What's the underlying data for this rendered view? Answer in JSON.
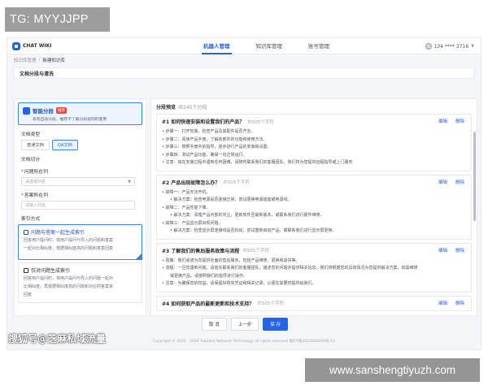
{
  "overlay": {
    "top_left_tag": "TG: MYYJJPP",
    "bottom_left_watermark": "搜狐号@芝麻私域流量",
    "bottom_right_tag": "www.sanshengtiyuzh.com"
  },
  "app": {
    "logo": "CHAT WIKI",
    "nav": [
      "机器人管理",
      "知识库管理",
      "账号管理"
    ],
    "active_nav": "机器人管理",
    "user": "134 **** 3716"
  },
  "breadcrumb": {
    "parent": "知识库管理",
    "sep": "/",
    "current": "新建知识库"
  },
  "section_title": "文档分段与清洗",
  "left": {
    "mode": {
      "title": "智能分段",
      "badge": "推荐",
      "desc": "系统自动分段，推荐不了解分段规则的使用"
    },
    "doc_type_label": "文档类型",
    "doc_types": [
      "普通文档",
      "QA文档"
    ],
    "active_doc_type": "QA文档",
    "split_label": "文档切分",
    "q_col_label": "问题所在列",
    "q_col_placeholder": "请选择列名",
    "a_col_label": "答案所在列",
    "a_col_placeholder": "请输入列名",
    "index_label": "索引方式",
    "index_options": [
      {
        "title": "问题与答案一起生成索引",
        "desc": "回答用户提问时，将用户提问与导入的问题和答案",
        "desc2": "一起对比相似度，根据相似度高的问题和答案回复"
      },
      {
        "title": "仅对问题生成索引",
        "desc": "回答用户提问时，将用户提问与导入的问题一起对",
        "desc2": "比相似度，再根据相似度高的问题和对应的答案来",
        "desc3": "回复"
      }
    ]
  },
  "preview": {
    "title": "分段预览",
    "count": "共345个分段",
    "edit": "编辑",
    "delete": "删除",
    "items": [
      {
        "head": "#1 如何快速安装和设置我们的产品？",
        "chars": "共505个字符",
        "lines": [
          "• 步骤一：打开包装，检查产品及其配件是否齐全。",
          "• 步骤二：阅读产品手册，了解各部件的功能和使用方法。",
          "• 步骤三：按照手册中的指导，逐步进行产品的安装和设置。",
          "• 步骤四：测试产品功能，确保一切正常运行。",
          "• 注意：如在安装过程中遇到任何困难，请随时联系我们的客服团队，我们将为您提供远程指导或上门服务"
        ]
      },
      {
        "head": "#2 产品出现故障怎么办？",
        "chars": "共505个字符",
        "lines": [
          "• 故障一：产品无法开机。",
          "  • 解决方案：检查电源是否连接正常，尝试更换电源插座或电源线。",
          "• 故障二：产品性能下降。",
          "  • 解决方案：清理产品内部的灰尘，更新软件至最新版本，或联系我们进行硬件维修。",
          "• 故障三：产品显示屏出现问题。",
          "  • 解决方案：检查显示屏连接线是否松动，尝试重新启动产品，或联系我们进行显示屏更换。"
        ]
      },
      {
        "head": "#3 了解我们的售后服务政策与流程",
        "chars": "共505个字符",
        "lines": [
          "• 政策：我们承诺为您提供全面的售后服务，包括产品维修、更换和退货等。",
          "• 流程：一旦您遇到问题，请首先联系我们的客服团队，描述您的问题并提供相关信息。我们将根据您的具体情况为您提供解决方案，如需维修",
          "  或更换产品，请按照我们的指导进行操作。",
          "• 注意：为确保您的权益，请保留好购买凭证和相关记录，以便在需要时提供给我们。"
        ]
      },
      {
        "head": "#4 如何获取产品的最新更新和技术支持？",
        "chars": "共505个字符",
        "lines": []
      }
    ]
  },
  "actions": {
    "cancel": "取 消",
    "prev": "上一步",
    "save": "保 存"
  },
  "footer": "Copyright © 2016 - 2024 Tubaline Network Technology all rights reserved  蜀ICP备2022000209号-12"
}
